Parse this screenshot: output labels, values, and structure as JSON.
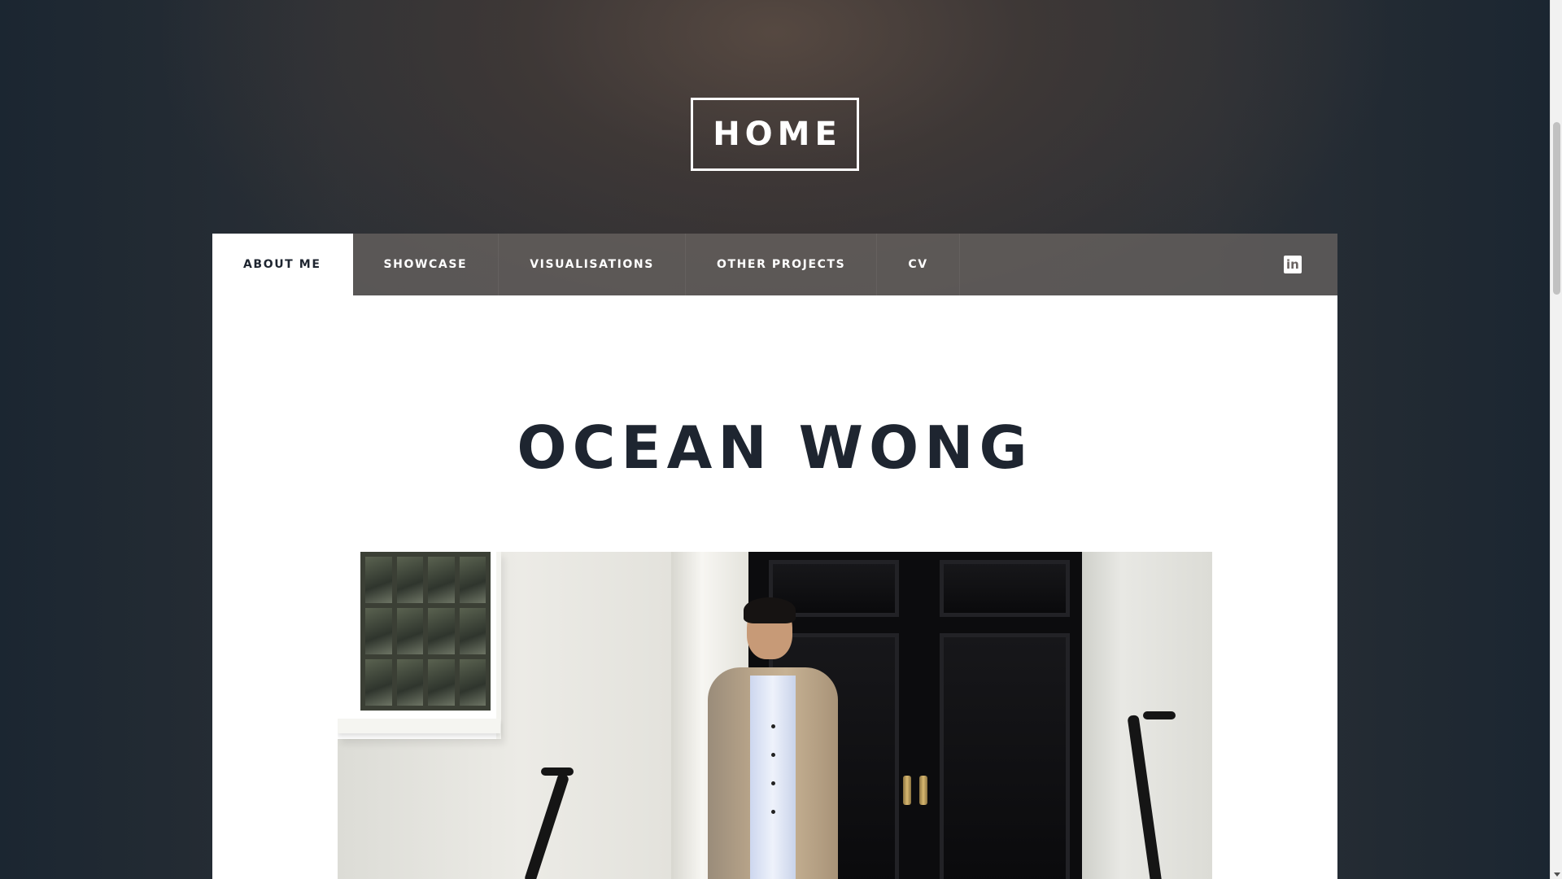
{
  "header": {
    "home_label": "HOME"
  },
  "nav": {
    "items": [
      {
        "label": "ABOUT ME",
        "active": true
      },
      {
        "label": "SHOWCASE",
        "active": false
      },
      {
        "label": "VISUALISATIONS",
        "active": false
      },
      {
        "label": "OTHER PROJECTS",
        "active": false
      },
      {
        "label": "CV",
        "active": false
      }
    ],
    "social_icon": "linkedin-icon"
  },
  "main": {
    "name": "OCEAN WONG",
    "photo_icon": "portrait-photo"
  },
  "colors": {
    "text_dark": "#1e2530",
    "nav_bg": "#6c6664",
    "panel_bg": "#ffffff",
    "page_bg": "#1f2730"
  }
}
